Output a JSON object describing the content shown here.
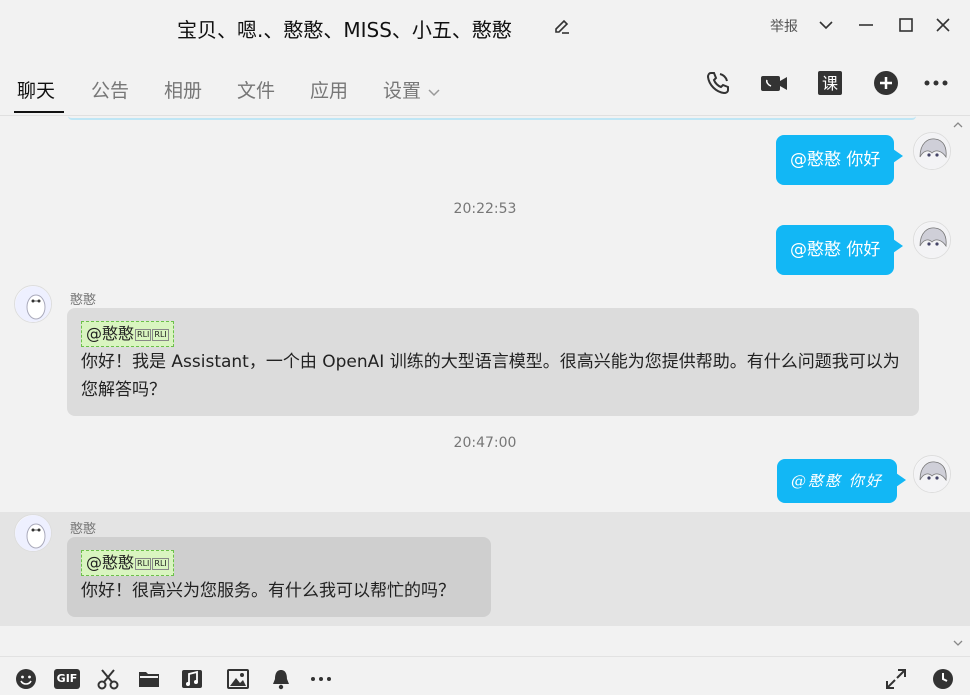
{
  "window": {
    "title": "宝贝、嗯.、憨憨、MISS、小五、憨憨",
    "report_label": "举报"
  },
  "tabs": [
    {
      "label": "聊天"
    },
    {
      "label": "公告"
    },
    {
      "label": "相册"
    },
    {
      "label": "文件"
    },
    {
      "label": "应用"
    },
    {
      "label": "设置"
    }
  ],
  "toolbar_icons": [
    "phone-icon",
    "video-icon",
    "class-icon",
    "add-icon",
    "more-icon"
  ],
  "chat": {
    "messages": [
      {
        "type": "out",
        "text": "@憨憨 你好"
      },
      {
        "type": "timestamp",
        "text": "20:22:53"
      },
      {
        "type": "out",
        "text": "@憨憨 你好"
      },
      {
        "type": "in",
        "sender": "憨憨",
        "mention": "@憨憨",
        "rli": "RLI",
        "text": "你好！我是 Assistant，一个由 OpenAI 训练的大型语言模型。很高兴能为您提供帮助。有什么问题我可以为您解答吗？"
      },
      {
        "type": "timestamp",
        "text": "20:47:00"
      },
      {
        "type": "out",
        "text": "@憨憨 你好"
      },
      {
        "type": "in",
        "sender": "憨憨",
        "mention": "@憨憨",
        "rli": "RLI",
        "text": "你好！很高兴为您服务。有什么我可以帮忙的吗？"
      }
    ]
  },
  "bottom_icons": [
    "emoji-icon",
    "gif-icon",
    "scissors-icon",
    "folder-icon",
    "music-icon",
    "image-icon",
    "bell-icon",
    "more-icon",
    "expand-icon",
    "history-icon"
  ],
  "bottom_gif_label": "GIF",
  "colors": {
    "accent": "#12b7f5",
    "incoming": "#dcdcdc",
    "mention": "#d9f5c0"
  }
}
